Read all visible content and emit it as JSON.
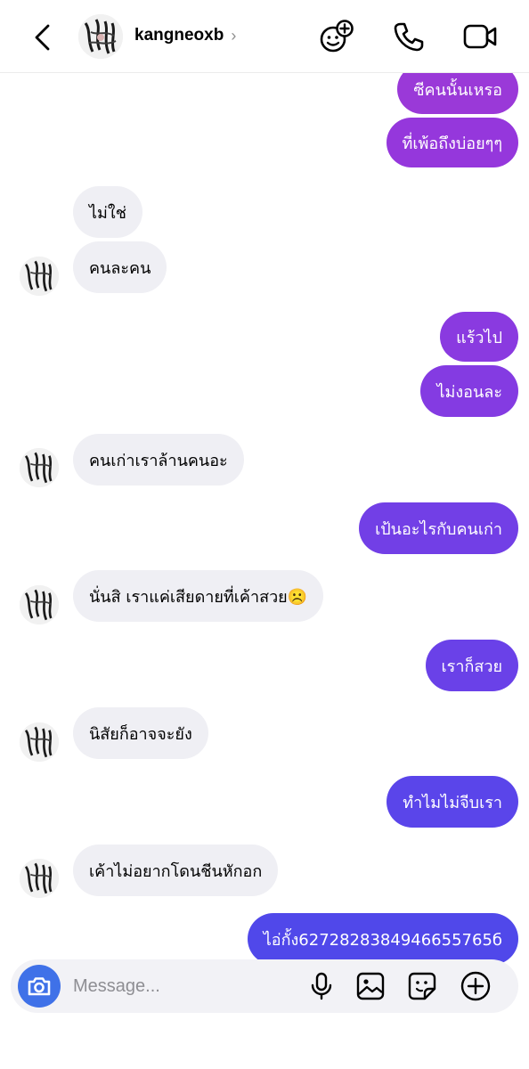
{
  "header": {
    "username": "kangneoxb",
    "chevron": "›",
    "icons": [
      "back-chevron-icon",
      "effects-icon",
      "phone-call-icon",
      "video-call-icon"
    ]
  },
  "messages": [
    {
      "side": "out",
      "text": "ซีคนนั้นเหรอ",
      "color": "#9a39d8"
    },
    {
      "side": "out",
      "text": "ที่เพ้อถึงบ่อยๆๆ",
      "color": "#9537dc"
    },
    {
      "side": "in",
      "text": "ไม่ใช่"
    },
    {
      "side": "in",
      "text": "คนละคน"
    },
    {
      "side": "out",
      "text": "แร้วไป",
      "color": "#8a3ae0"
    },
    {
      "side": "out",
      "text": "ไม่งอนละ",
      "color": "#843be2"
    },
    {
      "side": "in",
      "text": "คนเก่าเราล้านคนอะ"
    },
    {
      "side": "out",
      "text": "เป้นอะไรกับคนเก่า",
      "color": "#723fe6"
    },
    {
      "side": "in",
      "text": "นั่นสิ เราแค่เสียดายที่เค้าสวย☹️"
    },
    {
      "side": "out",
      "text": "เราก็สวย",
      "color": "#6a41e8"
    },
    {
      "side": "in",
      "text": "นิสัยก็อาจจะยัง"
    },
    {
      "side": "out",
      "text": "ทำไมไม่จีบเรา",
      "color": "#5a45ea"
    },
    {
      "side": "in",
      "text": "เค้าไม่อยากโดนชีนหักอก"
    },
    {
      "side": "out",
      "text": "ไอ่กั้ง6272828384946655765б",
      "color": "#5048ea"
    }
  ],
  "composer": {
    "placeholder": "Message...",
    "icons": [
      "camera-icon",
      "microphone-icon",
      "gallery-icon",
      "sticker-icon",
      "plus-icon"
    ],
    "camera_color": "#3f71e8"
  }
}
